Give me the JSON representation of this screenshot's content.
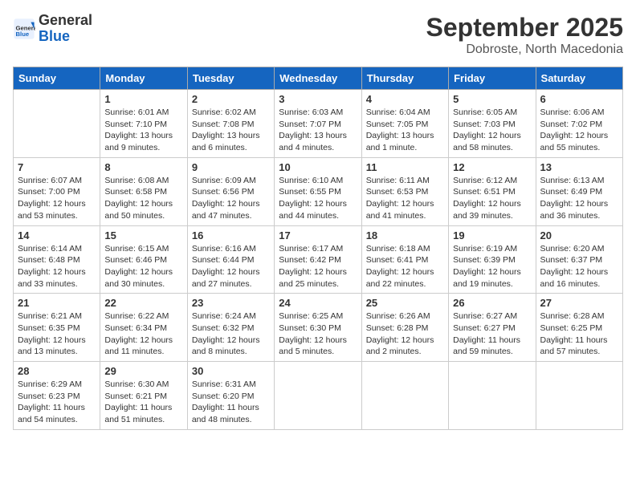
{
  "header": {
    "logo_general": "General",
    "logo_blue": "Blue",
    "month_title": "September 2025",
    "subtitle": "Dobroste, North Macedonia"
  },
  "days_of_week": [
    "Sunday",
    "Monday",
    "Tuesday",
    "Wednesday",
    "Thursday",
    "Friday",
    "Saturday"
  ],
  "weeks": [
    [
      {
        "day": "",
        "info": ""
      },
      {
        "day": "1",
        "info": "Sunrise: 6:01 AM\nSunset: 7:10 PM\nDaylight: 13 hours\nand 9 minutes."
      },
      {
        "day": "2",
        "info": "Sunrise: 6:02 AM\nSunset: 7:08 PM\nDaylight: 13 hours\nand 6 minutes."
      },
      {
        "day": "3",
        "info": "Sunrise: 6:03 AM\nSunset: 7:07 PM\nDaylight: 13 hours\nand 4 minutes."
      },
      {
        "day": "4",
        "info": "Sunrise: 6:04 AM\nSunset: 7:05 PM\nDaylight: 13 hours\nand 1 minute."
      },
      {
        "day": "5",
        "info": "Sunrise: 6:05 AM\nSunset: 7:03 PM\nDaylight: 12 hours\nand 58 minutes."
      },
      {
        "day": "6",
        "info": "Sunrise: 6:06 AM\nSunset: 7:02 PM\nDaylight: 12 hours\nand 55 minutes."
      }
    ],
    [
      {
        "day": "7",
        "info": "Sunrise: 6:07 AM\nSunset: 7:00 PM\nDaylight: 12 hours\nand 53 minutes."
      },
      {
        "day": "8",
        "info": "Sunrise: 6:08 AM\nSunset: 6:58 PM\nDaylight: 12 hours\nand 50 minutes."
      },
      {
        "day": "9",
        "info": "Sunrise: 6:09 AM\nSunset: 6:56 PM\nDaylight: 12 hours\nand 47 minutes."
      },
      {
        "day": "10",
        "info": "Sunrise: 6:10 AM\nSunset: 6:55 PM\nDaylight: 12 hours\nand 44 minutes."
      },
      {
        "day": "11",
        "info": "Sunrise: 6:11 AM\nSunset: 6:53 PM\nDaylight: 12 hours\nand 41 minutes."
      },
      {
        "day": "12",
        "info": "Sunrise: 6:12 AM\nSunset: 6:51 PM\nDaylight: 12 hours\nand 39 minutes."
      },
      {
        "day": "13",
        "info": "Sunrise: 6:13 AM\nSunset: 6:49 PM\nDaylight: 12 hours\nand 36 minutes."
      }
    ],
    [
      {
        "day": "14",
        "info": "Sunrise: 6:14 AM\nSunset: 6:48 PM\nDaylight: 12 hours\nand 33 minutes."
      },
      {
        "day": "15",
        "info": "Sunrise: 6:15 AM\nSunset: 6:46 PM\nDaylight: 12 hours\nand 30 minutes."
      },
      {
        "day": "16",
        "info": "Sunrise: 6:16 AM\nSunset: 6:44 PM\nDaylight: 12 hours\nand 27 minutes."
      },
      {
        "day": "17",
        "info": "Sunrise: 6:17 AM\nSunset: 6:42 PM\nDaylight: 12 hours\nand 25 minutes."
      },
      {
        "day": "18",
        "info": "Sunrise: 6:18 AM\nSunset: 6:41 PM\nDaylight: 12 hours\nand 22 minutes."
      },
      {
        "day": "19",
        "info": "Sunrise: 6:19 AM\nSunset: 6:39 PM\nDaylight: 12 hours\nand 19 minutes."
      },
      {
        "day": "20",
        "info": "Sunrise: 6:20 AM\nSunset: 6:37 PM\nDaylight: 12 hours\nand 16 minutes."
      }
    ],
    [
      {
        "day": "21",
        "info": "Sunrise: 6:21 AM\nSunset: 6:35 PM\nDaylight: 12 hours\nand 13 minutes."
      },
      {
        "day": "22",
        "info": "Sunrise: 6:22 AM\nSunset: 6:34 PM\nDaylight: 12 hours\nand 11 minutes."
      },
      {
        "day": "23",
        "info": "Sunrise: 6:24 AM\nSunset: 6:32 PM\nDaylight: 12 hours\nand 8 minutes."
      },
      {
        "day": "24",
        "info": "Sunrise: 6:25 AM\nSunset: 6:30 PM\nDaylight: 12 hours\nand 5 minutes."
      },
      {
        "day": "25",
        "info": "Sunrise: 6:26 AM\nSunset: 6:28 PM\nDaylight: 12 hours\nand 2 minutes."
      },
      {
        "day": "26",
        "info": "Sunrise: 6:27 AM\nSunset: 6:27 PM\nDaylight: 11 hours\nand 59 minutes."
      },
      {
        "day": "27",
        "info": "Sunrise: 6:28 AM\nSunset: 6:25 PM\nDaylight: 11 hours\nand 57 minutes."
      }
    ],
    [
      {
        "day": "28",
        "info": "Sunrise: 6:29 AM\nSunset: 6:23 PM\nDaylight: 11 hours\nand 54 minutes."
      },
      {
        "day": "29",
        "info": "Sunrise: 6:30 AM\nSunset: 6:21 PM\nDaylight: 11 hours\nand 51 minutes."
      },
      {
        "day": "30",
        "info": "Sunrise: 6:31 AM\nSunset: 6:20 PM\nDaylight: 11 hours\nand 48 minutes."
      },
      {
        "day": "",
        "info": ""
      },
      {
        "day": "",
        "info": ""
      },
      {
        "day": "",
        "info": ""
      },
      {
        "day": "",
        "info": ""
      }
    ]
  ]
}
